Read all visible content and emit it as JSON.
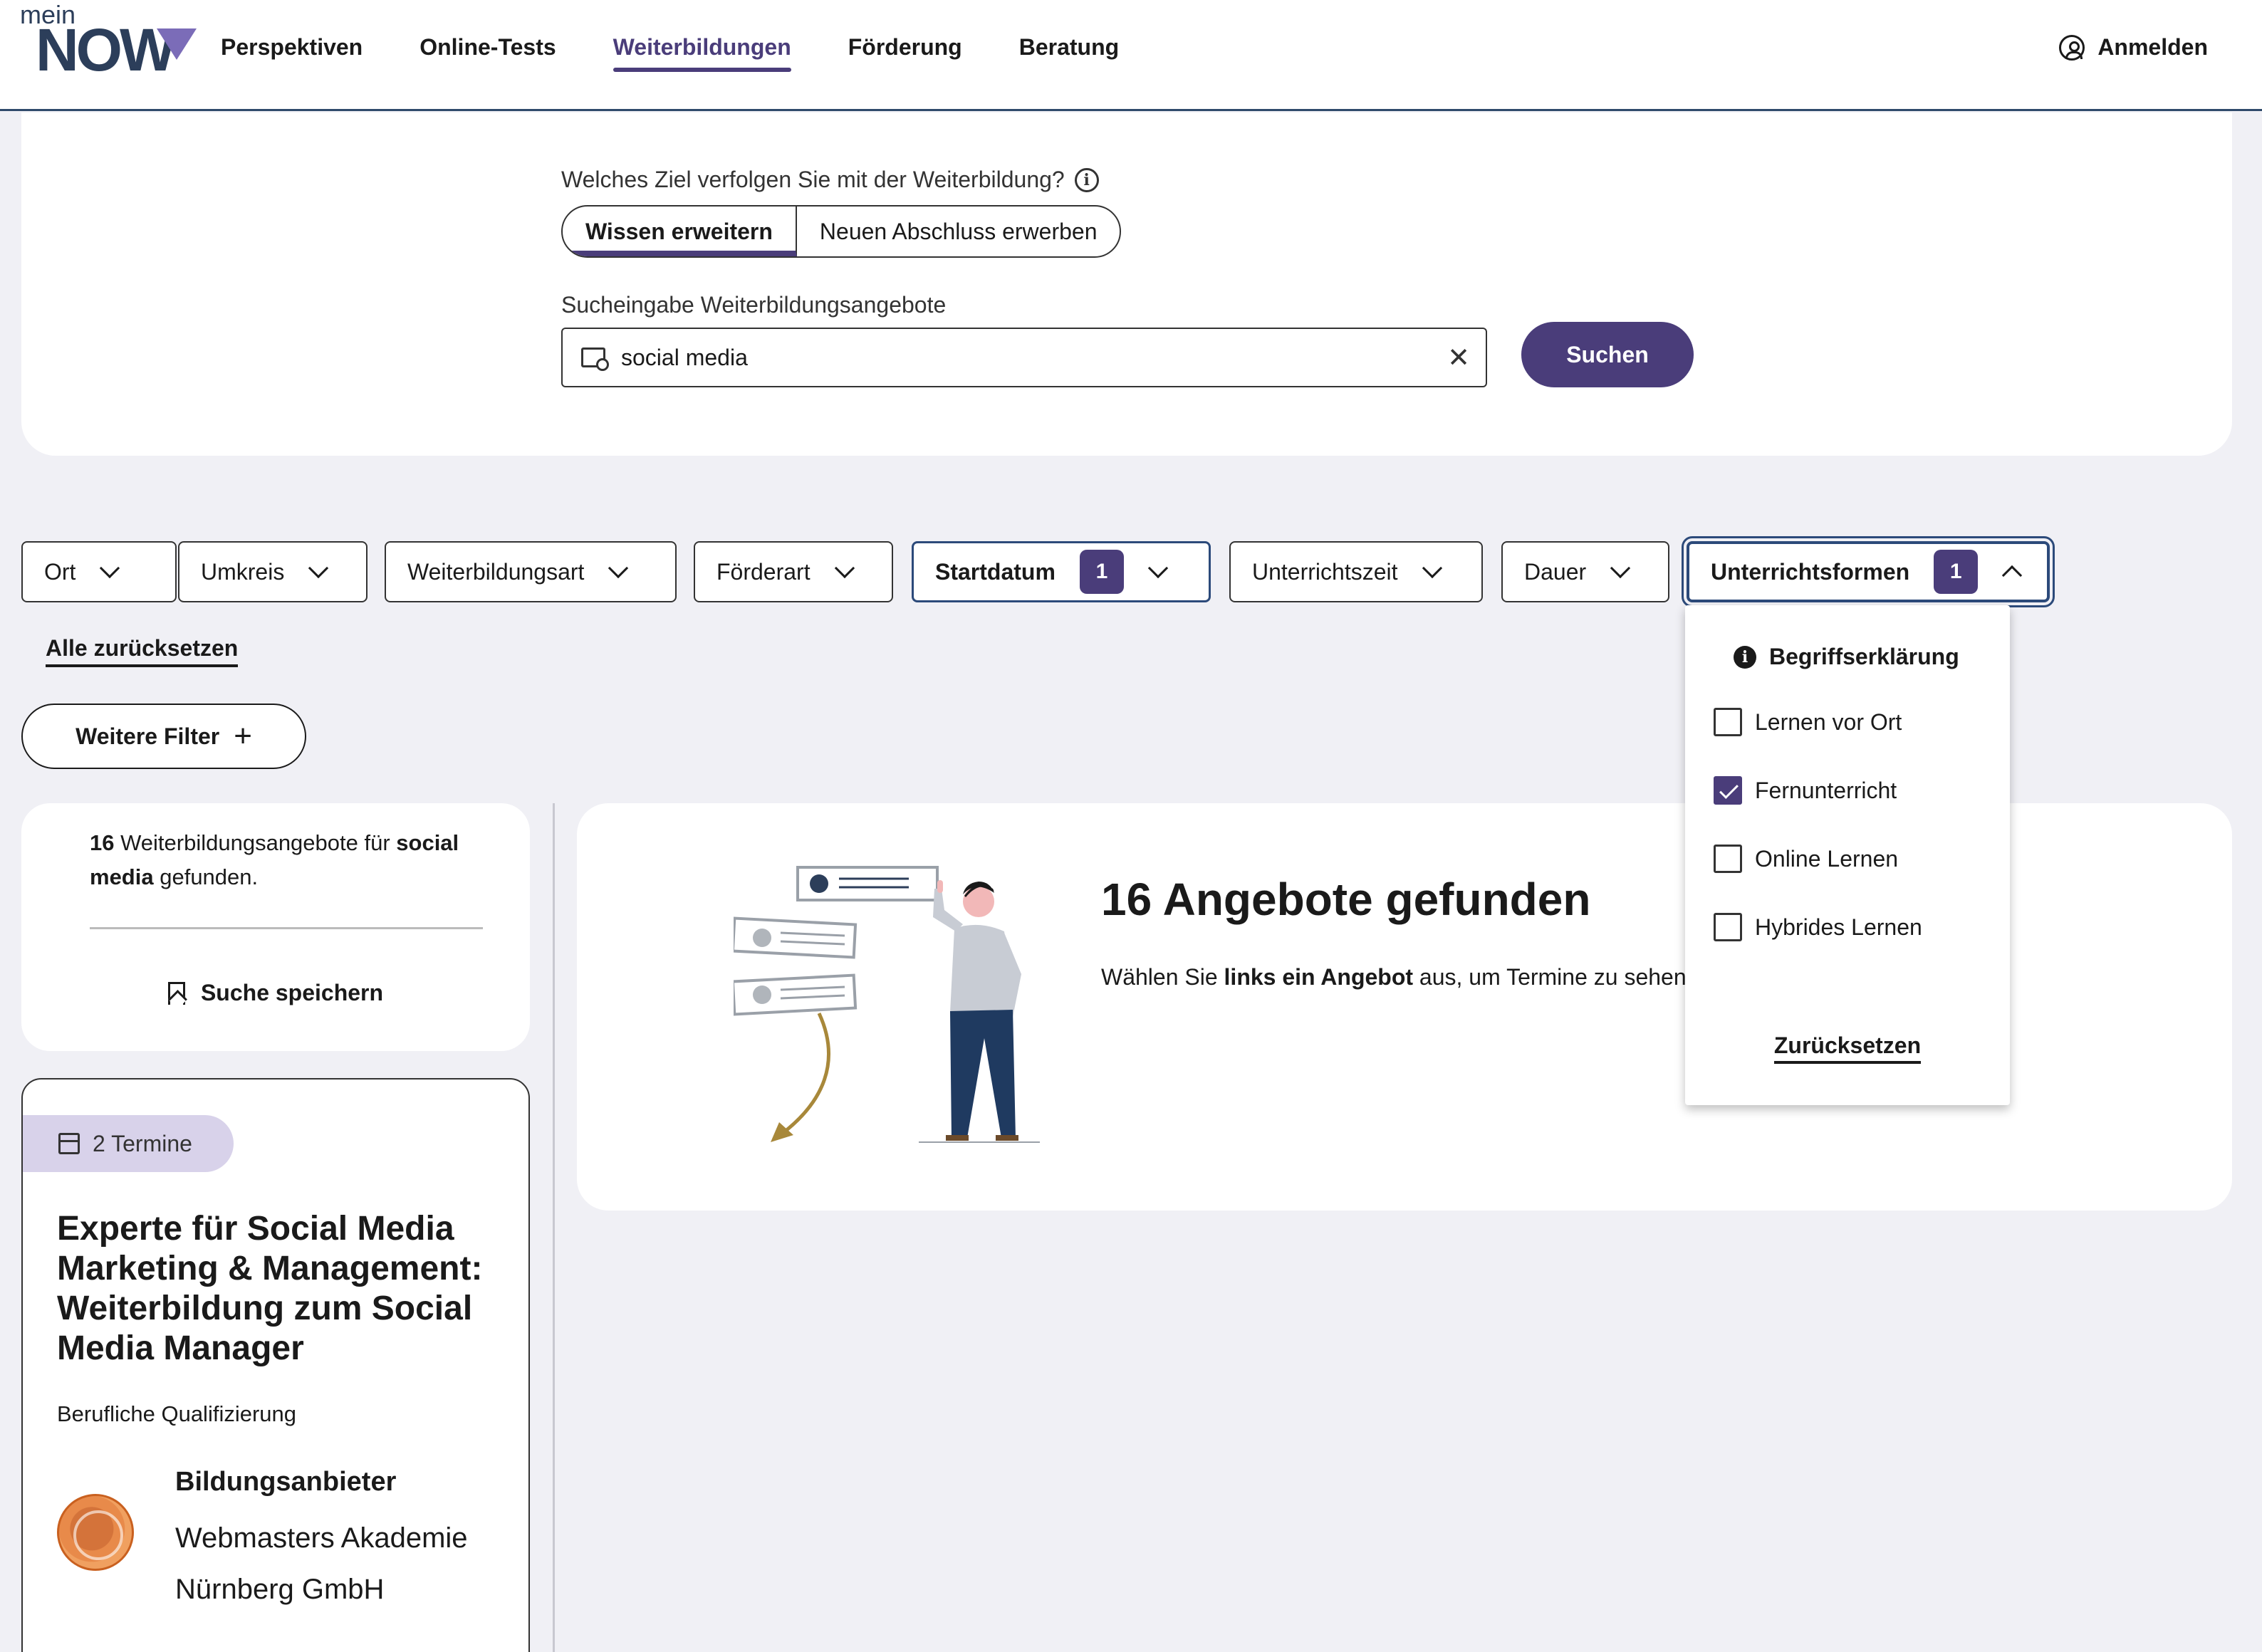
{
  "logo": {
    "small": "mein",
    "big": "NOW"
  },
  "nav": {
    "items": [
      {
        "label": "Perspektiven",
        "active": false
      },
      {
        "label": "Online-Tests",
        "active": false
      },
      {
        "label": "Weiterbildungen",
        "active": true
      },
      {
        "label": "Förderung",
        "active": false
      },
      {
        "label": "Beratung",
        "active": false
      }
    ],
    "login_label": "Anmelden"
  },
  "search": {
    "goal_label": "Welches Ziel verfolgen Sie mit der Weiterbildung?",
    "goal_options": [
      "Wissen erweitern",
      "Neuen Abschluss erwerben"
    ],
    "goal_selected": "Wissen erweitern",
    "input_label": "Sucheingabe Weiterbildungsangebote",
    "input_value": "social media",
    "clear_icon": "close-icon",
    "button_label": "Suchen"
  },
  "filters": {
    "chips": [
      {
        "label": "Ort"
      },
      {
        "label": "Umkreis"
      },
      {
        "label": "Weiterbildungsart"
      },
      {
        "label": "Förderart"
      },
      {
        "label": "Startdatum",
        "count": "1"
      },
      {
        "label": "Unterrichtszeit"
      },
      {
        "label": "Dauer"
      },
      {
        "label": "Unterrichtsformen",
        "count": "1"
      }
    ],
    "reset_all": "Alle zurücksetzen",
    "more_filters": "Weitere Filter"
  },
  "dropdown": {
    "heading": "Begriffserklärung",
    "options": [
      {
        "label": "Lernen vor Ort",
        "checked": false
      },
      {
        "label": "Fernunterricht",
        "checked": true
      },
      {
        "label": "Online Lernen",
        "checked": false
      },
      {
        "label": "Hybrides Lernen",
        "checked": false
      }
    ],
    "reset": "Zurücksetzen"
  },
  "summary": {
    "count": "16",
    "text_mid": " Weiterbildungsangebote für ",
    "query": "social media",
    "text_end": " gefunden.",
    "save_label": "Suche speichern"
  },
  "card": {
    "termine": "2 Termine",
    "title": "Experte für Social Media Marketing & Management: Weiterbildung zum Social Media Manager",
    "type": "Berufliche Qualifizierung",
    "provider_label": "Bildungsanbieter",
    "provider_name": "Webmasters Akademie Nürnberg GmbH"
  },
  "results": {
    "title": "16 Angebote gefunden",
    "text_pre": "Wählen Sie ",
    "text_bold": "links ein Angebot",
    "text_post": " aus, um Termine zu sehen"
  },
  "colors": {
    "accent": "#4a3d7a",
    "badge_bg": "#d8d2ea",
    "background": "#f0f0f5",
    "border_focus": "#2c4a7a"
  }
}
